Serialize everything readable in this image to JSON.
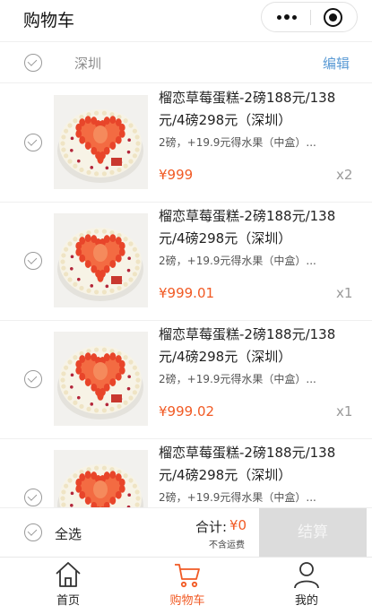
{
  "header": {
    "title": "购物车"
  },
  "shop": {
    "name": "深圳",
    "edit_label": "编辑"
  },
  "items": [
    {
      "title": "榴恋草莓蛋糕-2磅188元/138元/4磅298元（深圳）",
      "spec": "2磅，+19.9元得水果（中盒）...",
      "price": "¥999",
      "qty": "x2"
    },
    {
      "title": "榴恋草莓蛋糕-2磅188元/138元/4磅298元（深圳）",
      "spec": "2磅，+19.9元得水果（中盒）...",
      "price": "¥999.01",
      "qty": "x1"
    },
    {
      "title": "榴恋草莓蛋糕-2磅188元/138元/4磅298元（深圳）",
      "spec": "2磅，+19.9元得水果（中盒）...",
      "price": "¥999.02",
      "qty": "x1"
    },
    {
      "title": "榴恋草莓蛋糕-2磅188元/138元/4磅298元（深圳）",
      "spec": "2磅，+19.9元得水果（中盒）...",
      "price": "",
      "qty": ""
    }
  ],
  "checkout": {
    "select_all": "全选",
    "total_label": "合计:",
    "total_value": "¥0",
    "shipping_note": "不含运费",
    "settle_label": "结算"
  },
  "tabbar": [
    {
      "label": "首页",
      "icon": "home-icon",
      "active": false
    },
    {
      "label": "购物车",
      "icon": "cart-icon",
      "active": true
    },
    {
      "label": "我的",
      "icon": "user-icon",
      "active": false
    }
  ],
  "colors": {
    "accent": "#f15a24",
    "link": "#5b9bd5",
    "disabled_button": "#dcdcdc"
  }
}
